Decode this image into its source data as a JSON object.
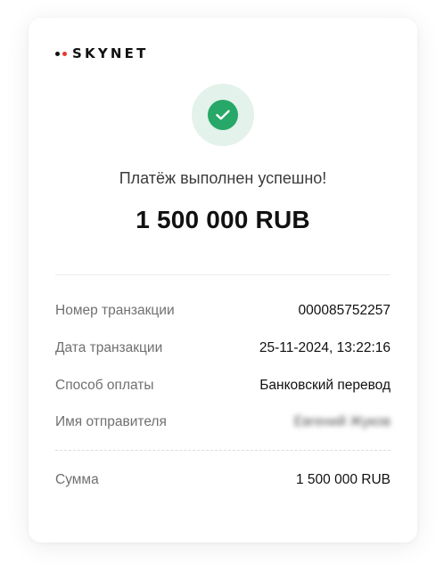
{
  "brand": {
    "name": "SKYNET",
    "colors": {
      "dot_dark": "#111111",
      "dot_red": "#e23b2e"
    }
  },
  "status": {
    "icon": "check-icon",
    "message": "Платёж выполнен успешно!",
    "color": "#27a868"
  },
  "amount": "1 500 000 RUB",
  "details": [
    {
      "label": "Номер транзакции",
      "value": "000085752257"
    },
    {
      "label": "Дата транзакции",
      "value": "25-11-2024, 13:22:16"
    },
    {
      "label": "Способ оплаты",
      "value": "Банковский перевод"
    },
    {
      "label": "Имя отправителя",
      "value": "Евгений Жуков"
    }
  ],
  "total": {
    "label": "Сумма",
    "value": "1 500 000 RUB"
  }
}
